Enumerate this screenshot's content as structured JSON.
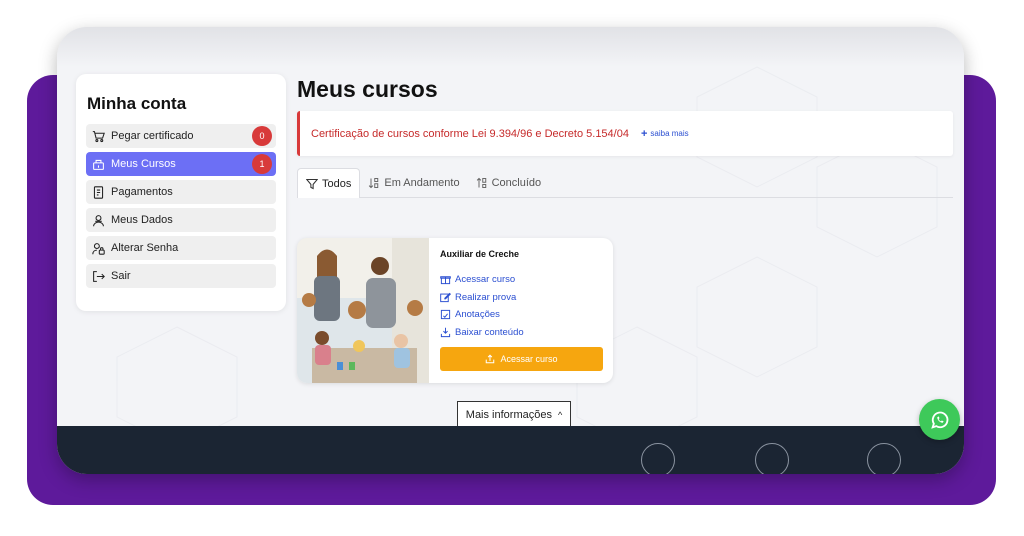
{
  "sidebar": {
    "title": "Minha conta",
    "items": [
      {
        "label": "Pegar certificado",
        "icon": "cart-icon",
        "badge": "0"
      },
      {
        "label": "Meus Cursos",
        "icon": "courses-icon",
        "badge": "1"
      },
      {
        "label": "Pagamentos",
        "icon": "receipt-icon"
      },
      {
        "label": "Meus Dados",
        "icon": "user-data-icon"
      },
      {
        "label": "Alterar Senha",
        "icon": "user-lock-icon"
      },
      {
        "label": "Sair",
        "icon": "logout-icon"
      }
    ]
  },
  "main": {
    "title": "Meus cursos",
    "alert": {
      "text": "Certificação de cursos conforme Lei 9.394/96 e Decreto 5.154/04",
      "link_label": "saiba mais"
    },
    "tabs": [
      {
        "label": "Todos",
        "icon": "filter-icon",
        "active": true
      },
      {
        "label": "Em Andamento",
        "icon": "sort-down-icon"
      },
      {
        "label": "Concluído",
        "icon": "sort-up-icon"
      }
    ],
    "course": {
      "title": "Auxiliar de Creche",
      "links": [
        {
          "label": "Acessar curso",
          "icon": "gift-icon"
        },
        {
          "label": "Realizar prova",
          "icon": "pencil-icon"
        },
        {
          "label": "Anotações",
          "icon": "notes-icon"
        },
        {
          "label": "Baixar conteúdo",
          "icon": "download-icon"
        }
      ],
      "button_label": "Acessar curso"
    }
  },
  "more_info": "Mais informações",
  "colors": {
    "accent": "#6c6ff5",
    "purple_background": "#5e1a9b",
    "alert_red": "#d83a3a",
    "button_orange": "#f6a60f",
    "footer": "#1b2533",
    "whatsapp": "#3ec95a"
  }
}
